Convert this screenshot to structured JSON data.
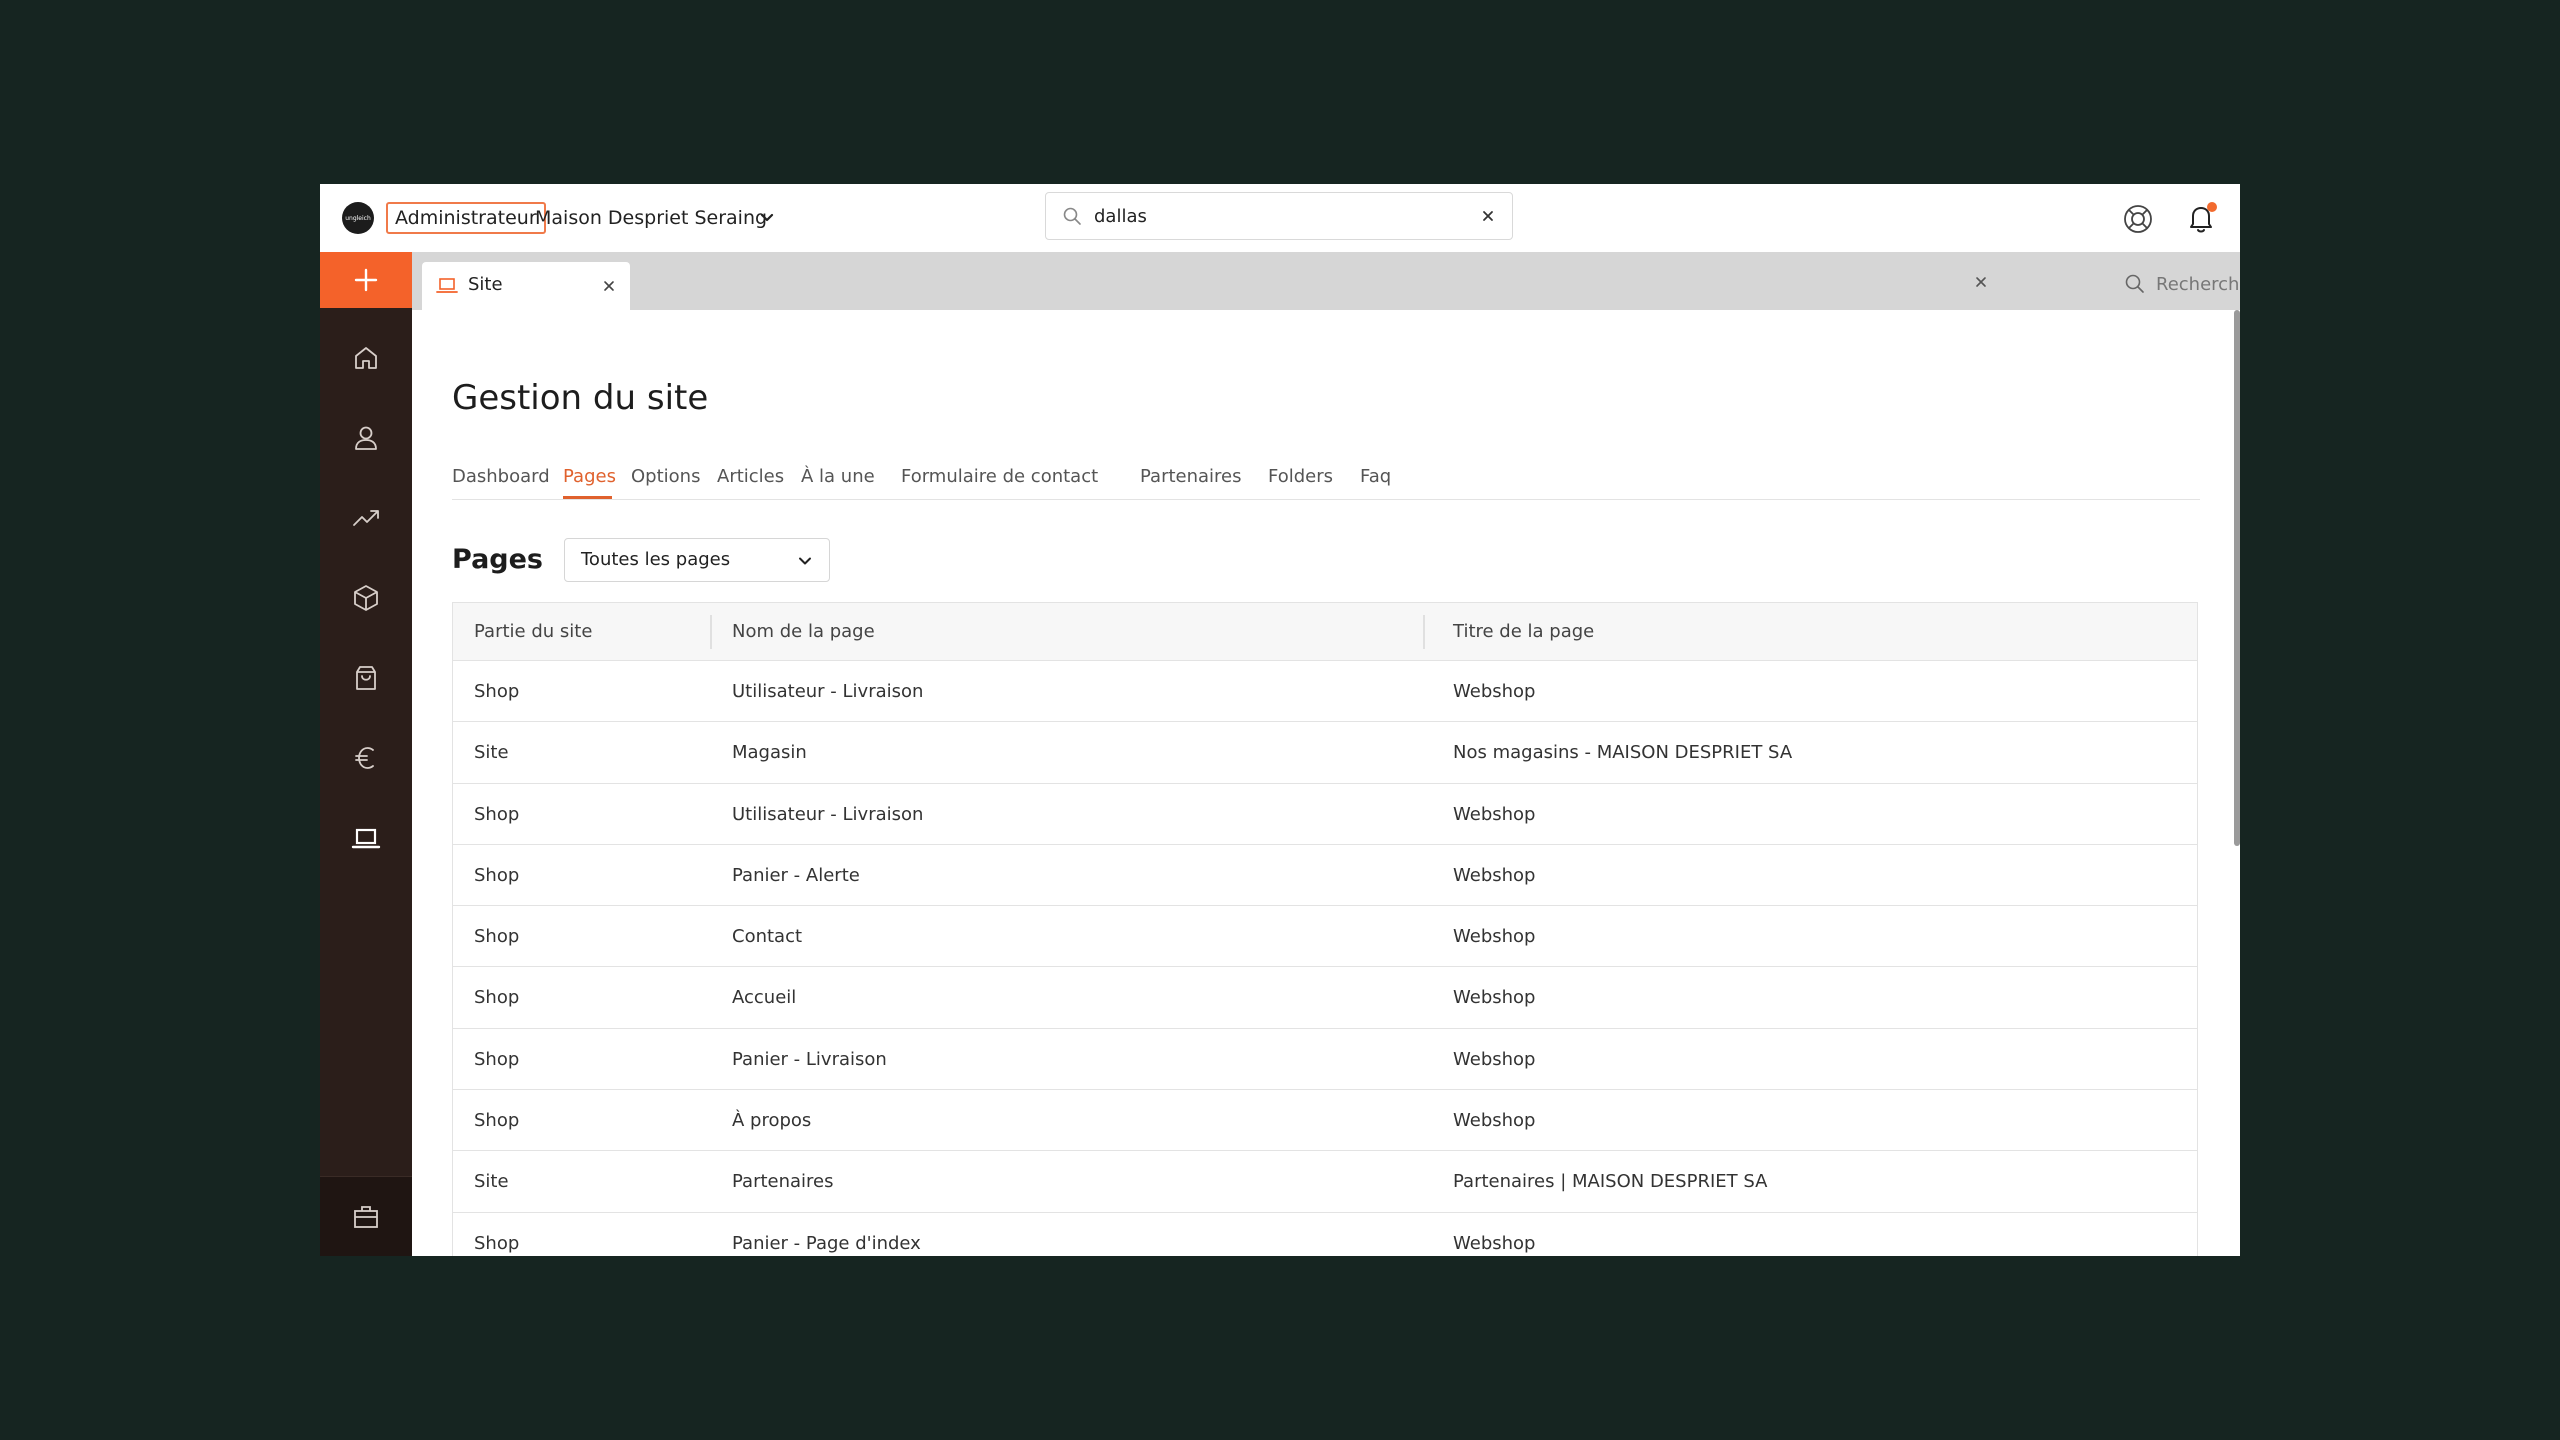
{
  "topbar": {
    "logo_text": "ungleich",
    "role": "Administrateur",
    "company": "Maison Despriet Seraing",
    "search_value": "dallas"
  },
  "tabs": [
    {
      "label": "Site"
    }
  ],
  "tabstrip": {
    "search_placeholder": "Recherche"
  },
  "page": {
    "title": "Gestion du site",
    "subnav": [
      {
        "label": "Dashboard",
        "active": false
      },
      {
        "label": "Pages",
        "active": true
      },
      {
        "label": "Options",
        "active": false
      },
      {
        "label": "Articles",
        "active": false
      },
      {
        "label": "À la une",
        "active": false
      },
      {
        "label": "Formulaire de contact",
        "active": false
      },
      {
        "label": "Partenaires",
        "active": false
      },
      {
        "label": "Folders",
        "active": false
      },
      {
        "label": "Faq",
        "active": false
      }
    ],
    "section_title": "Pages",
    "filter_selected": "Toutes les pages"
  },
  "table": {
    "columns": [
      "Partie du site",
      "Nom de la page",
      "Titre de la page"
    ],
    "rows": [
      [
        "Shop",
        "Utilisateur - Livraison",
        "Webshop"
      ],
      [
        "Site",
        "Magasin",
        "Nos magasins - MAISON DESPRIET SA"
      ],
      [
        "Shop",
        "Utilisateur - Livraison",
        "Webshop"
      ],
      [
        "Shop",
        "Panier - Alerte",
        "Webshop"
      ],
      [
        "Shop",
        "Contact",
        "Webshop"
      ],
      [
        "Shop",
        "Accueil",
        "Webshop"
      ],
      [
        "Shop",
        "Panier - Livraison",
        "Webshop"
      ],
      [
        "Shop",
        "À propos",
        "Webshop"
      ],
      [
        "Site",
        "Partenaires",
        "Partenaires | MAISON DESPRIET SA"
      ],
      [
        "Shop",
        "Panier - Page d'index",
        "Webshop"
      ]
    ]
  },
  "sidebar": {
    "items": [
      {
        "icon": "home-icon"
      },
      {
        "icon": "user-icon"
      },
      {
        "icon": "trending-up-icon"
      },
      {
        "icon": "box-icon"
      },
      {
        "icon": "shopping-bag-icon"
      },
      {
        "icon": "euro-icon"
      },
      {
        "icon": "laptop-icon"
      }
    ]
  },
  "colors": {
    "accent": "#f4622a",
    "sidebar_bg": "#2b1e1a",
    "backdrop": "#162521"
  }
}
